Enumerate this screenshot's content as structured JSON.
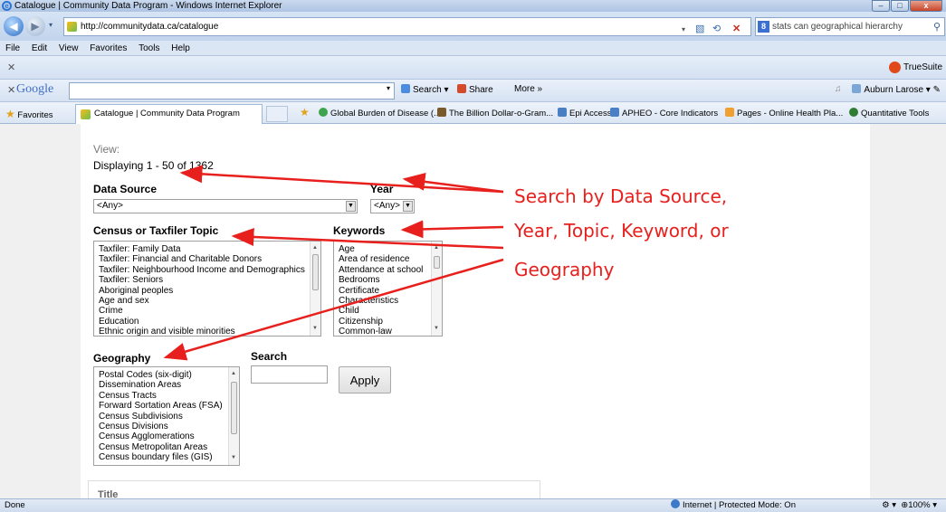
{
  "browser": {
    "window_title": "Catalogue | Community Data Program - Windows Internet Explorer",
    "url": "http://communitydata.ca/catalogue",
    "search_text": "stats can geographical hierarchy",
    "menu": [
      "File",
      "Edit",
      "View",
      "Favorites",
      "Tools",
      "Help"
    ],
    "truesuite_label": "TrueSuite",
    "google": {
      "logo": "Google",
      "search_label": "Search",
      "share_label": "Share",
      "more_label": "More »",
      "user": "Auburn Larose"
    },
    "favorites_label": "Favorites",
    "active_tab": "Catalogue | Community Data Program",
    "bookmarks": [
      "Global Burden of Disease (...",
      "The Billion Dollar-o-Gram...",
      "Epi Access",
      "APHEO - Core Indicators",
      "Pages - Online Health Pla...",
      "Quantitative Tools"
    ],
    "status": {
      "left": "Done",
      "zone": "Internet | Protected Mode: On",
      "zoom": "100%"
    }
  },
  "page": {
    "view_label": "View:",
    "displaying": "Displaying 1 - 50 of 1362",
    "data_source_label": "Data Source",
    "data_source_value": "<Any>",
    "year_label": "Year",
    "year_value": "<Any>",
    "topic_label": "Census or Taxfiler Topic",
    "topics": [
      "Taxfiler: Family Data",
      "Taxfiler: Financial and Charitable Donors",
      "Taxfiler: Neighbourhood Income and Demographics",
      "Taxfiler: Seniors",
      "Aboriginal peoples",
      "Age and sex",
      "Crime",
      "Education",
      "Ethnic origin and visible minorities"
    ],
    "keywords_label": "Keywords",
    "keywords": [
      "Age",
      "Area of residence",
      "Attendance at school",
      "Bedrooms",
      "Certificate",
      "Characteristics",
      "Child",
      "Citizenship",
      "Common-law"
    ],
    "geography_label": "Geography",
    "geographies": [
      "Postal Codes (six-digit)",
      "Dissemination Areas",
      "Census Tracts",
      "Forward Sortation Areas (FSA)",
      "Census Subdivisions",
      "Census Divisions",
      "Census Agglomerations",
      "Census Metropolitan Areas",
      "Census boundary files (GIS)"
    ],
    "search_label": "Search",
    "apply_label": "Apply",
    "title_header": "Title"
  },
  "annotation": {
    "lines": [
      "Search by Data Source,",
      "Year, Topic, Keyword, or",
      "Geography"
    ],
    "color": "#e8201d"
  }
}
